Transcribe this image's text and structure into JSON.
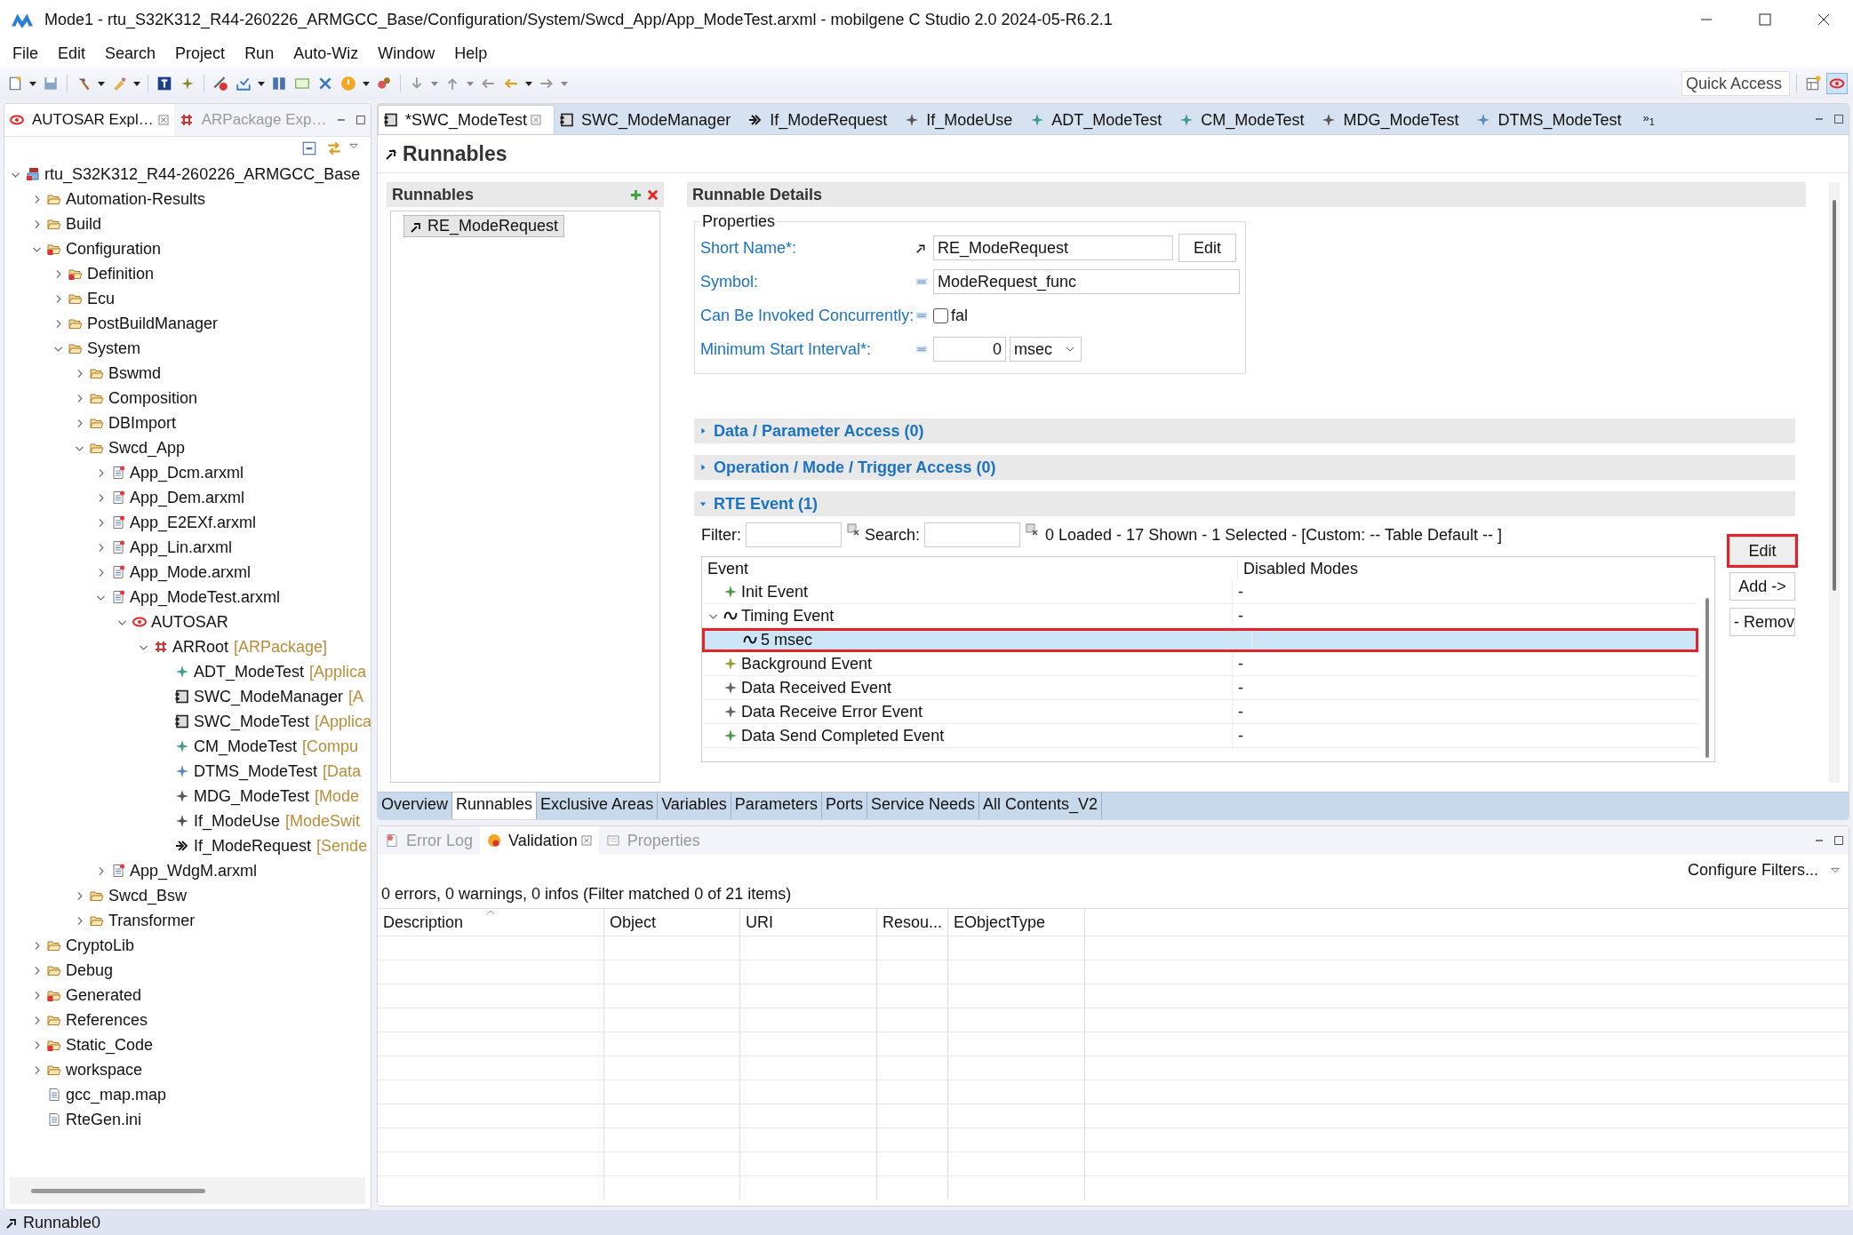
{
  "window": {
    "title": "Mode1 - rtu_S32K312_R44-260226_ARMGCC_Base/Configuration/System/Swcd_App/App_ModeTest.arxml - mobilgene C Studio 2.0 2024-05-R6.2.1"
  },
  "menu": [
    "File",
    "Edit",
    "Search",
    "Project",
    "Run",
    "Auto-Wiz",
    "Window",
    "Help"
  ],
  "quick_access": {
    "placeholder": "Quick Access"
  },
  "explorer": {
    "tabs": [
      {
        "label": "AUTOSAR Expl…",
        "kind": "autosar",
        "selected": true,
        "closable": true
      },
      {
        "label": "ARPackage Exp…",
        "kind": "package",
        "selected": false,
        "closable": false
      }
    ],
    "tree": [
      {
        "label": "rtu_S32K312_R44-260226_ARMGCC_Base",
        "kind": "project",
        "expanded": true,
        "children": [
          {
            "label": "Automation-Results",
            "kind": "folder",
            "expanded": false
          },
          {
            "label": "Build",
            "kind": "folder",
            "expanded": false
          },
          {
            "label": "Configuration",
            "kind": "folder-error",
            "expanded": true,
            "children": [
              {
                "label": "Definition",
                "kind": "folder-error",
                "expanded": false
              },
              {
                "label": "Ecu",
                "kind": "folder",
                "expanded": false
              },
              {
                "label": "PostBuildManager",
                "kind": "folder",
                "expanded": false
              },
              {
                "label": "System",
                "kind": "folder",
                "expanded": true,
                "children": [
                  {
                    "label": "Bswmd",
                    "kind": "folder",
                    "expanded": false
                  },
                  {
                    "label": "Composition",
                    "kind": "folder",
                    "expanded": false
                  },
                  {
                    "label": "DBImport",
                    "kind": "folder",
                    "expanded": false
                  },
                  {
                    "label": "Swcd_App",
                    "kind": "folder",
                    "expanded": true,
                    "children": [
                      {
                        "label": "App_Dcm.arxml",
                        "kind": "arxml",
                        "expanded": false
                      },
                      {
                        "label": "App_Dem.arxml",
                        "kind": "arxml",
                        "expanded": false
                      },
                      {
                        "label": "App_E2EXf.arxml",
                        "kind": "arxml",
                        "expanded": false
                      },
                      {
                        "label": "App_Lin.arxml",
                        "kind": "arxml",
                        "expanded": false
                      },
                      {
                        "label": "App_Mode.arxml",
                        "kind": "arxml",
                        "expanded": false
                      },
                      {
                        "label": "App_ModeTest.arxml",
                        "kind": "arxml",
                        "expanded": true,
                        "children": [
                          {
                            "label": "AUTOSAR",
                            "kind": "autosar",
                            "expanded": true,
                            "children": [
                              {
                                "label": "ARRoot",
                                "type": "[ARPackage]",
                                "kind": "package",
                                "expanded": true,
                                "children": [
                                  {
                                    "label": "ADT_ModeTest",
                                    "type": "[Applica",
                                    "kind": "datatype"
                                  },
                                  {
                                    "label": "SWC_ModeManager",
                                    "type": "[A",
                                    "kind": "component"
                                  },
                                  {
                                    "label": "SWC_ModeTest",
                                    "type": "[Applica",
                                    "kind": "component"
                                  },
                                  {
                                    "label": "CM_ModeTest",
                                    "type": "[Compu",
                                    "kind": "datatype"
                                  },
                                  {
                                    "label": "DTMS_ModeTest",
                                    "type": "[Data",
                                    "kind": "mapping"
                                  },
                                  {
                                    "label": "MDG_ModeTest",
                                    "type": "[Mode",
                                    "kind": "modegroup"
                                  },
                                  {
                                    "label": "If_ModeUse",
                                    "type": "[ModeSwit",
                                    "kind": "modegroup"
                                  },
                                  {
                                    "label": "If_ModeRequest",
                                    "type": "[Sende",
                                    "kind": "sender"
                                  }
                                ]
                              }
                            ]
                          }
                        ]
                      },
                      {
                        "label": "App_WdgM.arxml",
                        "kind": "arxml",
                        "expanded": false
                      }
                    ]
                  },
                  {
                    "label": "Swcd_Bsw",
                    "kind": "folder",
                    "expanded": false
                  },
                  {
                    "label": "Transformer",
                    "kind": "folder",
                    "expanded": false
                  }
                ]
              }
            ]
          },
          {
            "label": "CryptoLib",
            "kind": "folder",
            "expanded": false
          },
          {
            "label": "Debug",
            "kind": "folder",
            "expanded": false
          },
          {
            "label": "Generated",
            "kind": "folder-error",
            "expanded": false
          },
          {
            "label": "References",
            "kind": "folder",
            "expanded": false
          },
          {
            "label": "Static_Code",
            "kind": "folder-error",
            "expanded": false
          },
          {
            "label": "workspace",
            "kind": "folder",
            "expanded": false
          },
          {
            "label": "gcc_map.map",
            "kind": "file"
          },
          {
            "label": "RteGen.ini",
            "kind": "file"
          }
        ]
      }
    ]
  },
  "editor_tabs": [
    {
      "label": "*SWC_ModeTest",
      "kind": "component",
      "selected": true,
      "closable": true
    },
    {
      "label": "SWC_ModeManager",
      "kind": "component",
      "selected": false,
      "closable": false
    },
    {
      "label": "If_ModeRequest",
      "kind": "sender",
      "selected": false,
      "closable": false
    },
    {
      "label": "If_ModeUse",
      "kind": "modegroup",
      "selected": false,
      "closable": false
    },
    {
      "label": "ADT_ModeTest",
      "kind": "datatype",
      "selected": false,
      "closable": false
    },
    {
      "label": "CM_ModeTest",
      "kind": "datatype",
      "selected": false,
      "closable": false
    },
    {
      "label": "MDG_ModeTest",
      "kind": "modegroup",
      "selected": false,
      "closable": false
    },
    {
      "label": "DTMS_ModeTest",
      "kind": "mapping",
      "selected": false,
      "closable": false
    }
  ],
  "editor_overflow": "»$_{1}$",
  "page_title": "Runnables",
  "runnables": {
    "title": "Runnables",
    "items": [
      {
        "label": "RE_ModeRequest",
        "selected": true
      }
    ]
  },
  "details": {
    "title": "Runnable Details",
    "properties": {
      "title": "Properties",
      "short_name": {
        "label": "Short Name*:",
        "value": "RE_ModeRequest",
        "button": "Edit"
      },
      "symbol": {
        "label": "Symbol:",
        "value": "ModeRequest_func"
      },
      "concurrent": {
        "label": "Can Be Invoked Concurrently:",
        "checked": false,
        "text": "fal"
      },
      "min_start": {
        "label": "Minimum Start Interval*:",
        "value": "0",
        "unit": "msec"
      }
    },
    "sections": [
      {
        "title": "Data / Parameter Access (0)",
        "expanded": false
      },
      {
        "title": "Operation / Mode / Trigger Access (0)",
        "expanded": false
      },
      {
        "title": "RTE Event (1)",
        "expanded": true
      }
    ],
    "rte_event": {
      "filter_label": "Filter:",
      "search_label": "Search:",
      "status": "0 Loaded - 17 Shown - 1 Selected -  [Custom: -- Table Default -- ]",
      "columns": [
        "Event",
        "Disabled Modes"
      ],
      "rows": [
        {
          "event": "Init Event",
          "kind": "init",
          "disabled_modes": "-",
          "selected": false,
          "highlighted": false
        },
        {
          "event": "Timing Event",
          "kind": "timing",
          "disabled_modes": "-",
          "selected": false,
          "highlighted": false,
          "expanded": true,
          "children": [
            {
              "event": "5 msec",
              "kind": "timing",
              "selected": true,
              "highlighted": true
            }
          ]
        },
        {
          "event": "Background Event",
          "kind": "background",
          "disabled_modes": "-",
          "selected": false,
          "highlighted": false
        },
        {
          "event": "Data Received Event",
          "kind": "receive",
          "disabled_modes": "-",
          "selected": false,
          "highlighted": false
        },
        {
          "event": "Data Receive Error Event",
          "kind": "receive",
          "disabled_modes": "-",
          "selected": false,
          "highlighted": false
        },
        {
          "event": "Data Send Completed Event",
          "kind": "init",
          "disabled_modes": "-",
          "selected": false,
          "highlighted": false
        }
      ],
      "buttons": [
        {
          "label": "Edit",
          "highlighted": true
        },
        {
          "label": "Add ->",
          "highlighted": false
        },
        {
          "label": "- Remov",
          "highlighted": false
        }
      ]
    }
  },
  "editor_pages": [
    {
      "label": "Overview",
      "selected": false
    },
    {
      "label": "Runnables",
      "selected": true
    },
    {
      "label": "Exclusive Areas",
      "selected": false
    },
    {
      "label": "Variables",
      "selected": false
    },
    {
      "label": "Parameters",
      "selected": false
    },
    {
      "label": "Ports",
      "selected": false
    },
    {
      "label": "Service Needs",
      "selected": false
    },
    {
      "label": "All Contents_V2",
      "selected": false
    }
  ],
  "lower_panel": {
    "tabs": [
      {
        "label": "Error Log",
        "kind": "errorlog",
        "selected": false,
        "closable": false
      },
      {
        "label": "Validation",
        "kind": "validation",
        "selected": true,
        "closable": true
      },
      {
        "label": "Properties",
        "kind": "properties",
        "selected": false,
        "closable": false
      }
    ],
    "configure_filters": "Configure Filters...",
    "summary": "0 errors, 0 warnings, 0 infos (Filter matched 0 of 21 items)",
    "columns": [
      {
        "label": "Description",
        "sorted": true
      },
      {
        "label": "Object",
        "sorted": false
      },
      {
        "label": "URI",
        "sorted": false
      },
      {
        "label": "Resou...",
        "sorted": false
      },
      {
        "label": "EObjectType",
        "sorted": false
      }
    ]
  },
  "status_bar": {
    "text": "Runnable0"
  }
}
